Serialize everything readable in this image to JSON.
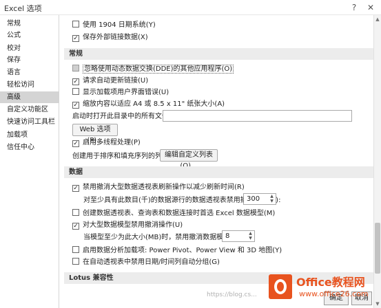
{
  "window": {
    "title": "Excel 选项",
    "help_glyph": "?",
    "close_glyph": "✕"
  },
  "sidebar": {
    "items": [
      {
        "label": "常规"
      },
      {
        "label": "公式"
      },
      {
        "label": "校对"
      },
      {
        "label": "保存"
      },
      {
        "label": "语言"
      },
      {
        "label": "轻松访问"
      },
      {
        "label": "高级",
        "active": true
      },
      {
        "label": "自定义功能区"
      },
      {
        "label": "快速访问工具栏"
      },
      {
        "label": "加载项"
      },
      {
        "label": "信任中心"
      }
    ]
  },
  "content": {
    "top_options": [
      {
        "label": "使用 1904 日期系统(Y)",
        "checked": false
      },
      {
        "label": "保存外部链接数据(X)",
        "checked": true
      }
    ],
    "general": {
      "header": "常规",
      "options": [
        {
          "label": "忽略使用动态数据交换(DDE)的其他应用程序(O)",
          "checked": false,
          "disabled": true
        },
        {
          "label": "请求自动更新链接(U)",
          "checked": true
        },
        {
          "label": "显示加载项用户界面错误(U)",
          "checked": false
        },
        {
          "label": "缩放内容以适应 A4 或 8.5 x 11\" 纸张大小(A)",
          "checked": true
        }
      ],
      "startup_label": "启动时打开此目录中的所有文件(L):",
      "startup_value": "",
      "web_button": "Web 选项(P)...",
      "multithread_label": "启用多线程处理(P)",
      "multithread_checked": true,
      "custom_list_label": "创建用于排序和填充序列的列表:",
      "custom_list_button": "编辑自定义列表(O)..."
    },
    "data": {
      "header": "数据",
      "undo_large_pivot": {
        "label": "禁用撤消大型数据透视表刷新操作以减少刷新时间(R)",
        "checked": true
      },
      "pivot_rows_label": "对至少具有此数目(千)的数据源行的数据透视表禁用撤消操作(N):",
      "pivot_rows_value": "300",
      "default_model": {
        "label": "创建数据透视表、查询表和数据连接时首选 Excel 数据模型(M)",
        "checked": false
      },
      "undo_large_model": {
        "label": "对大型数据模型禁用撤消操作(U)",
        "checked": true
      },
      "model_size_label": "当模型至少为此大小(MB)时，禁用撤消数据模型操作(L):",
      "model_size_value": "8",
      "analysis_addins": {
        "label": "启用数据分析加载项: Power Pivot、Power View 和 3D 地图(Y)",
        "checked": false
      },
      "date_grouping": {
        "label": "在自动透视表中禁用日期/时间列自动分组(G)",
        "checked": false
      }
    },
    "lotus": {
      "header": "Lotus 兼容性"
    }
  },
  "watermark": {
    "brand": "Office教程网",
    "url": "www.office26.com",
    "blog": "https://blog.cs..."
  },
  "footer": {
    "ok": "确定",
    "cancel": "取消"
  },
  "colors": {
    "accent": "#e8531f",
    "section_bg": "#ececec",
    "selected_nav": "#d4d4d4"
  },
  "icons": {
    "check": "✓",
    "spin_up": "▲",
    "spin_down": "▼",
    "scroll_up": "▲",
    "scroll_down": "▼"
  }
}
